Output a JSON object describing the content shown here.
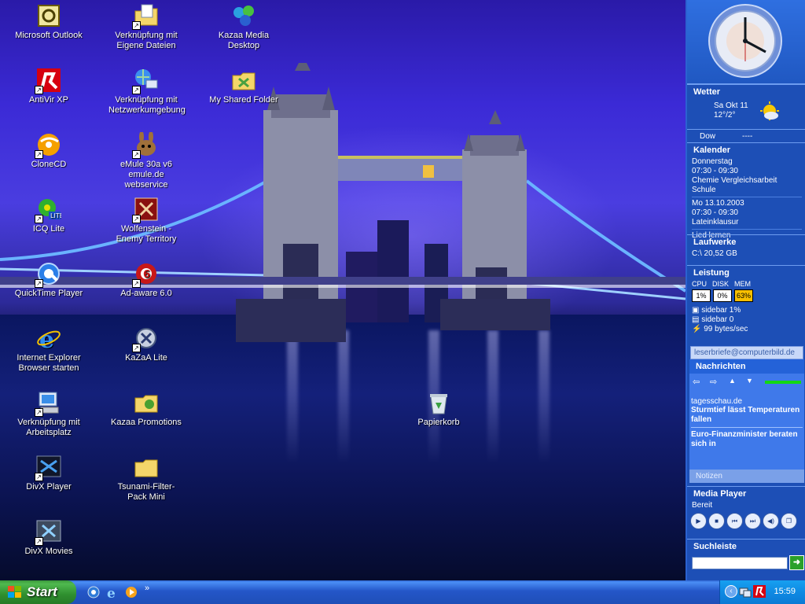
{
  "desktop": {
    "icons": [
      {
        "label": "Microsoft Outlook",
        "icon": "outlook-icon"
      },
      {
        "label": "Verknüpfung mit Eigene Dateien",
        "icon": "my-documents-icon"
      },
      {
        "label": "Kazaa Media Desktop",
        "icon": "kazaa-icon"
      },
      {
        "label": "AntiVir XP",
        "icon": "antivir-icon"
      },
      {
        "label": "Verknüpfung mit Netzwerkumgebung",
        "icon": "network-icon"
      },
      {
        "label": "My Shared Folder",
        "icon": "shared-folder-icon"
      },
      {
        "label": "CloneCD",
        "icon": "clonecd-icon"
      },
      {
        "label": "eMule 30a v6 emule.de webservice",
        "icon": "emule-icon"
      },
      {
        "label": "ICQ Lite",
        "icon": "icq-icon"
      },
      {
        "label": "Wolfenstein - Enemy Territory",
        "icon": "wolfenstein-icon"
      },
      {
        "label": "QuickTime Player",
        "icon": "quicktime-icon"
      },
      {
        "label": "Ad-aware 6.0",
        "icon": "adaware-icon"
      },
      {
        "label": "Internet Explorer Browser starten",
        "icon": "internet-explorer-icon"
      },
      {
        "label": "KaZaA Lite",
        "icon": "kazaa-lite-icon"
      },
      {
        "label": "Verknüpfung mit Arbeitsplatz",
        "icon": "my-computer-icon"
      },
      {
        "label": "Kazaa Promotions",
        "icon": "kazaa-promotions-icon"
      },
      {
        "label": "Papierkorb",
        "icon": "recycle-bin-icon"
      },
      {
        "label": "DivX Player",
        "icon": "divx-player-icon"
      },
      {
        "label": "Tsunami-Filter-Pack Mini",
        "icon": "folder-icon"
      },
      {
        "label": "DivX Movies",
        "icon": "divx-movies-icon"
      }
    ]
  },
  "sidebar": {
    "weather": {
      "title": "Wetter",
      "date": "Sa Okt 11",
      "temp": "12°/2°",
      "dow_label": "Dow",
      "dow_value": "----"
    },
    "calendar": {
      "title": "Kalender",
      "day": "Donnerstag",
      "time1": "07:30 - 09:30",
      "event1": "Chemie Vergleichsarbeit Schule",
      "date2": "Mo 13.10.2003",
      "time2": "07:30 - 09:30",
      "event2": "Lateinklausur",
      "task": "Lied lernen"
    },
    "drives": {
      "title": "Laufwerke",
      "c_drive": "C:\\ 20,52 GB"
    },
    "performance": {
      "title": "Leistung",
      "cpu_label": "CPU",
      "disk_label": "DISK",
      "mem_label": "MEM",
      "cpu_value": "1%",
      "disk_value": "0%",
      "mem_value": "63%",
      "proc1": "sidebar 1%",
      "proc2": "sidebar 0",
      "net": "99 bytes/sec"
    },
    "email_tab": "leserbriefe@computerbild.de",
    "news": {
      "title": "Nachrichten",
      "source": "tagesschau.de",
      "headline1": "Sturmtief lässt Temperaturen fallen",
      "headline2": "Euro-Finanzminister beraten sich in"
    },
    "notes_tab": "Notizen",
    "media_player": {
      "title": "Media Player",
      "status": "Bereit"
    },
    "search": {
      "title": "Suchleiste",
      "placeholder": ""
    }
  },
  "taskbar": {
    "start_label": "Start",
    "quicklaunch_more": "»",
    "clock": "15:59"
  },
  "colors": {
    "sidebar_bg": "#1d4fb6",
    "taskbar_blue": "#2456c8",
    "start_green": "#3c9a3c",
    "mem_warning": "#f8c000"
  }
}
